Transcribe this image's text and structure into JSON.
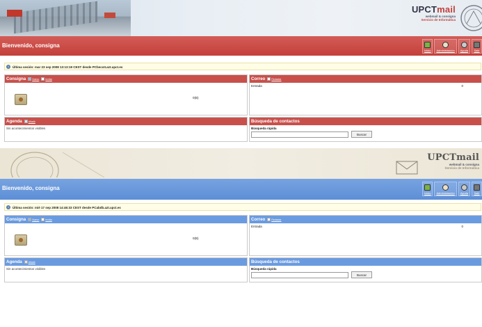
{
  "variants": [
    {
      "brand": {
        "name_a": "UPCT",
        "name_b": "mail",
        "line1": "webmail & consigna",
        "line2": "Servicio de Informática"
      },
      "welcome": "Bienvenido, consigna",
      "toolbar": [
        {
          "label": "Inicio"
        },
        {
          "label": "Administración"
        },
        {
          "label": "Ayuda"
        },
        {
          "label": "Salir"
        }
      ],
      "session": "Última sesión: mar 23 sep 2008 13:13:19 CEST desde PCbecsII.azt.upct.es",
      "consigna": {
        "title": "Consigna",
        "new": "Nuevo",
        "invite": "Invitar",
        "count": "0(B)"
      },
      "correo": {
        "title": "Correo",
        "compose": "Redactar",
        "inbox_name": "Entrada",
        "inbox_count": "0"
      },
      "agenda": {
        "title": "Agenda",
        "add": "Añadir",
        "empty": "Sin acontecimientos visibles"
      },
      "busqueda": {
        "title": "Búsqueda de contactos",
        "quick_label": "Búsqueda rápida",
        "button": "Buscar",
        "placeholder": ""
      }
    },
    {
      "brand": {
        "name_a": "UPCT",
        "name_b": "mail",
        "line1": "webmail & consigna",
        "line2": "Servicio de Informática"
      },
      "welcome": "Bienvenido, consigna",
      "toolbar": [
        {
          "label": "Inicio"
        },
        {
          "label": "Administración"
        },
        {
          "label": "Ayuda"
        },
        {
          "label": "Salir"
        }
      ],
      "session": "Última sesión: mié 17 sep 2008 14:46:33 CEST desde PCabdb.azt.upct.es",
      "consigna": {
        "title": "Consigna",
        "new": "Nuevo",
        "invite": "Invitar",
        "count": "0(B)"
      },
      "correo": {
        "title": "Correo",
        "compose": "Redactar",
        "inbox_name": "Entrada",
        "inbox_count": "0"
      },
      "agenda": {
        "title": "Agenda",
        "add": "Añadir",
        "empty": "Sin acontecimientos visibles"
      },
      "busqueda": {
        "title": "Búsqueda de contactos",
        "quick_label": "Búsqueda rápida",
        "button": "Buscar",
        "placeholder": ""
      }
    }
  ],
  "colors": {
    "variant1_accent": "#c8504b",
    "variant2_accent": "#6a9be0",
    "session_bg": "#fffde6"
  },
  "icons": [
    "info-icon",
    "inicio-icon",
    "administracion-icon",
    "ayuda-icon",
    "salir-icon",
    "nuevo-icon",
    "invitar-icon",
    "redactar-icon",
    "anadir-icon",
    "consigna-box-icon",
    "envelope-icon"
  ]
}
